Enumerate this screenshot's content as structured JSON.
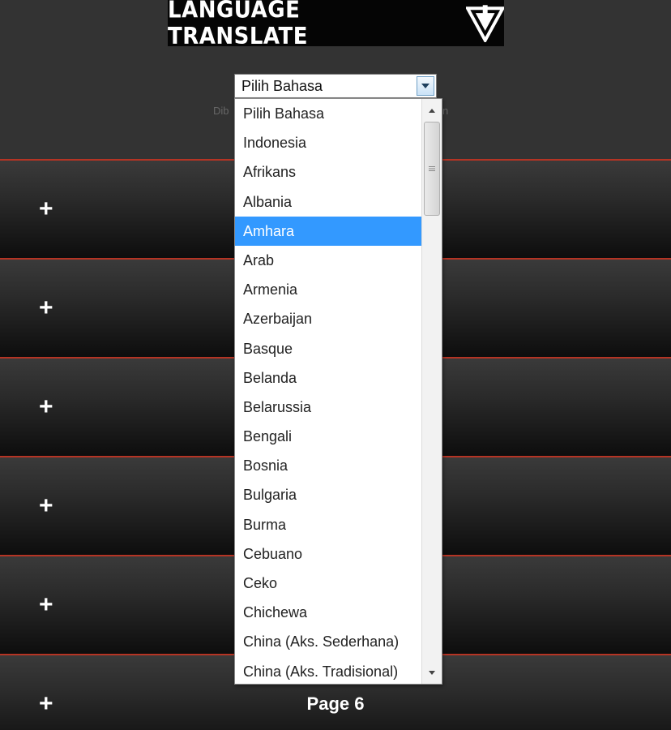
{
  "header": {
    "title": "LANGUAGE TRANSLATE",
    "logo_icon": "inverted-triangle-arrow-icon"
  },
  "language_select": {
    "value": "Pilih Bahasa",
    "partial_note_left": "Dib",
    "partial_note_right": "n"
  },
  "dropdown": {
    "options": [
      "Pilih Bahasa",
      "Indonesia",
      "Afrikans",
      "Albania",
      "Amhara",
      "Arab",
      "Armenia",
      "Azerbaijan",
      "Basque",
      "Belanda",
      "Belarussia",
      "Bengali",
      "Bosnia",
      "Bulgaria",
      "Burma",
      "Cebuano",
      "Ceko",
      "Chichewa",
      "China (Aks. Sederhana)",
      "China (Aks. Tradisional)"
    ],
    "highlighted": "Amhara"
  },
  "pages": [
    {
      "icon": "plus-icon",
      "plus": "+",
      "label": ""
    },
    {
      "icon": "plus-icon",
      "plus": "+",
      "label": ""
    },
    {
      "icon": "plus-icon",
      "plus": "+",
      "label": ""
    },
    {
      "icon": "plus-icon",
      "plus": "+",
      "label": ""
    },
    {
      "icon": "plus-icon",
      "plus": "+",
      "label": ""
    },
    {
      "icon": "plus-icon",
      "plus": "+",
      "label": "Page 6"
    }
  ],
  "colors": {
    "background": "#333333",
    "row_border": "#b53424",
    "highlight": "#3399ff"
  }
}
